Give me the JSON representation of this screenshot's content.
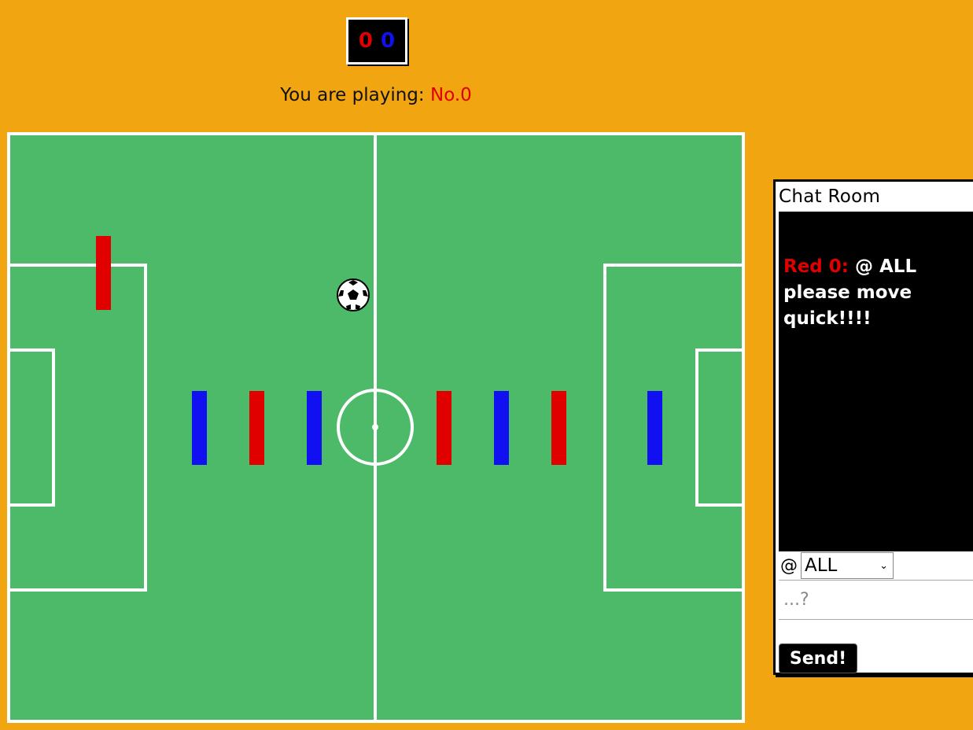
{
  "scoreboard": {
    "red_score": "0",
    "blue_score": "0"
  },
  "status": {
    "prefix": "You are playing: ",
    "player": "No.0"
  },
  "colors": {
    "red_team": "#e00000",
    "blue_team": "#1010f0",
    "pitch": "#4dba69",
    "background": "#f0a511"
  },
  "chat": {
    "title": "Chat Room",
    "messages": [
      {
        "author": "Red 0:",
        "text": " @ ALL please move quick!!!!"
      }
    ],
    "target_label": "@",
    "target_selected": "ALL",
    "input_placeholder": "...?",
    "send_label": "Send!"
  }
}
